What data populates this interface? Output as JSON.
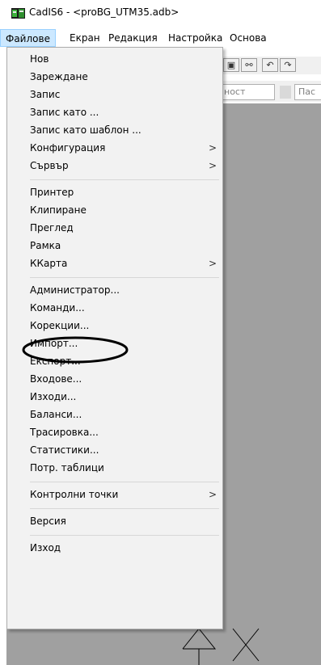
{
  "window": {
    "title": "CadIS6 - <proBG_UTM35.adb>",
    "icon": "cadis-app-icon"
  },
  "menubar": {
    "items": [
      {
        "label": "Файлове",
        "active": true
      },
      {
        "label": "Екран",
        "active": false
      },
      {
        "label": "Редакция",
        "active": false
      },
      {
        "label": "Настройка",
        "active": false
      },
      {
        "label": "Основа",
        "active": false
      }
    ]
  },
  "toolbar": {
    "buttons": [
      "view-icon",
      "glasses-icon",
      "undo-icon",
      "redo-icon"
    ]
  },
  "fields": {
    "field1_text": "ност",
    "field2_text": "Пас"
  },
  "file_menu": {
    "groups": [
      [
        {
          "label": "Нов",
          "submenu": false
        },
        {
          "label": "Зареждане",
          "submenu": false
        },
        {
          "label": "Запис",
          "submenu": false
        },
        {
          "label": "Запис като ...",
          "submenu": false
        },
        {
          "label": "Запис като шаблон ...",
          "submenu": false
        },
        {
          "label": "Конфигурация",
          "submenu": true
        },
        {
          "label": "Сървър",
          "submenu": true
        }
      ],
      [
        {
          "label": "Принтер",
          "submenu": false
        },
        {
          "label": "Клипиране",
          "submenu": false
        },
        {
          "label": "Преглед",
          "submenu": false
        },
        {
          "label": "Рамка",
          "submenu": false
        },
        {
          "label": "ККарта",
          "submenu": true
        }
      ],
      [
        {
          "label": "Администратор...",
          "submenu": false
        },
        {
          "label": "Команди...",
          "submenu": false,
          "circled": true
        },
        {
          "label": "Корекции...",
          "submenu": false
        },
        {
          "label": "Импорт...",
          "submenu": false
        },
        {
          "label": "Експорт...",
          "submenu": false
        },
        {
          "label": "Входове...",
          "submenu": false
        },
        {
          "label": "Изходи...",
          "submenu": false
        },
        {
          "label": "Баланси...",
          "submenu": false
        },
        {
          "label": "Трасировка...",
          "submenu": false
        },
        {
          "label": "Статистики...",
          "submenu": false
        },
        {
          "label": "Потр. таблици",
          "submenu": false
        }
      ],
      [
        {
          "label": "Контролни точки",
          "submenu": true
        }
      ],
      [
        {
          "label": "Версия",
          "submenu": false
        }
      ],
      [
        {
          "label": "Изход",
          "submenu": false
        }
      ]
    ],
    "submenu_arrow": ">"
  },
  "annotation": {
    "shape": "ellipse",
    "color": "#000000",
    "target": "Команди..."
  }
}
